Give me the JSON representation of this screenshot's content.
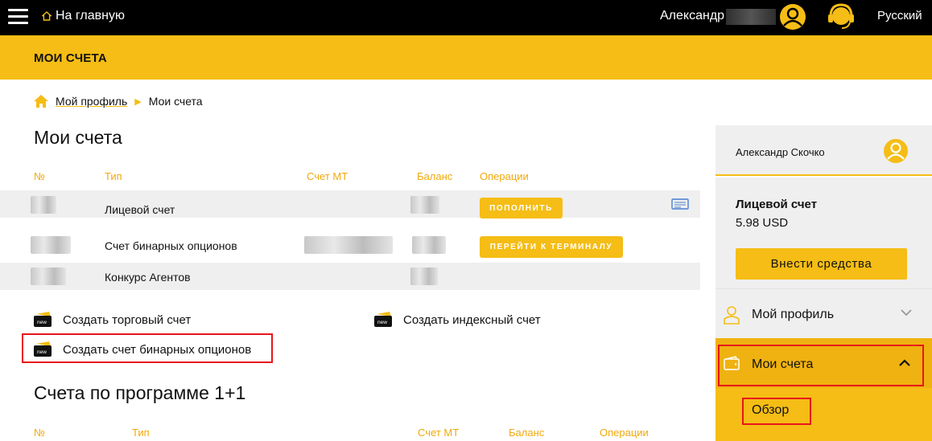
{
  "topbar": {
    "home_label": "На главную",
    "user_name": "Александр",
    "language": "Русский",
    "icons": [
      "hamburger-icon",
      "home-icon",
      "user-avatar-icon",
      "support-headset-icon"
    ]
  },
  "band": {
    "title": "МОИ СЧЕТА"
  },
  "breadcrumb": {
    "home": "Мой профиль",
    "current": "Мои счета"
  },
  "main": {
    "heading": "Мои счета",
    "table": {
      "columns": [
        "№",
        "Тип",
        "Счет MT",
        "Баланс",
        "Операции"
      ],
      "rows": [
        {
          "type": "Лицевой счет",
          "action": "ПОПОЛНИТЬ",
          "has_mt": false,
          "has_card_icon": true
        },
        {
          "type": "Счет бинарных опционов",
          "action": "ПЕРЕЙТИ К ТЕРМИНАЛУ",
          "has_mt": true,
          "has_card_icon": false
        },
        {
          "type": "Конкурс Агентов",
          "action": "",
          "has_mt": false,
          "has_card_icon": false
        }
      ]
    },
    "create_links": {
      "trading": "Создать торговый счет",
      "index": "Создать индексный счет",
      "binary": "Создать счет бинарных опционов",
      "badge": "new"
    },
    "heading_2": "Счета по программе 1+1",
    "table_2": {
      "columns": [
        "№",
        "Тип",
        "Счет MT",
        "Баланс",
        "Операции"
      ]
    }
  },
  "sidebar": {
    "user_name": "Александр Скочко",
    "balance_title": "Лицевой счет",
    "balance_amount": "5.98 USD",
    "deposit_button": "Внести средства",
    "profile_label": "Мой профиль",
    "accounts_label": "Мои счета",
    "overview_label": "Обзор"
  },
  "colors": {
    "brand_yellow": "#f5bd15",
    "header_black": "#000000",
    "highlight_red": "#e8151b",
    "column_header": "#f0a90d"
  }
}
